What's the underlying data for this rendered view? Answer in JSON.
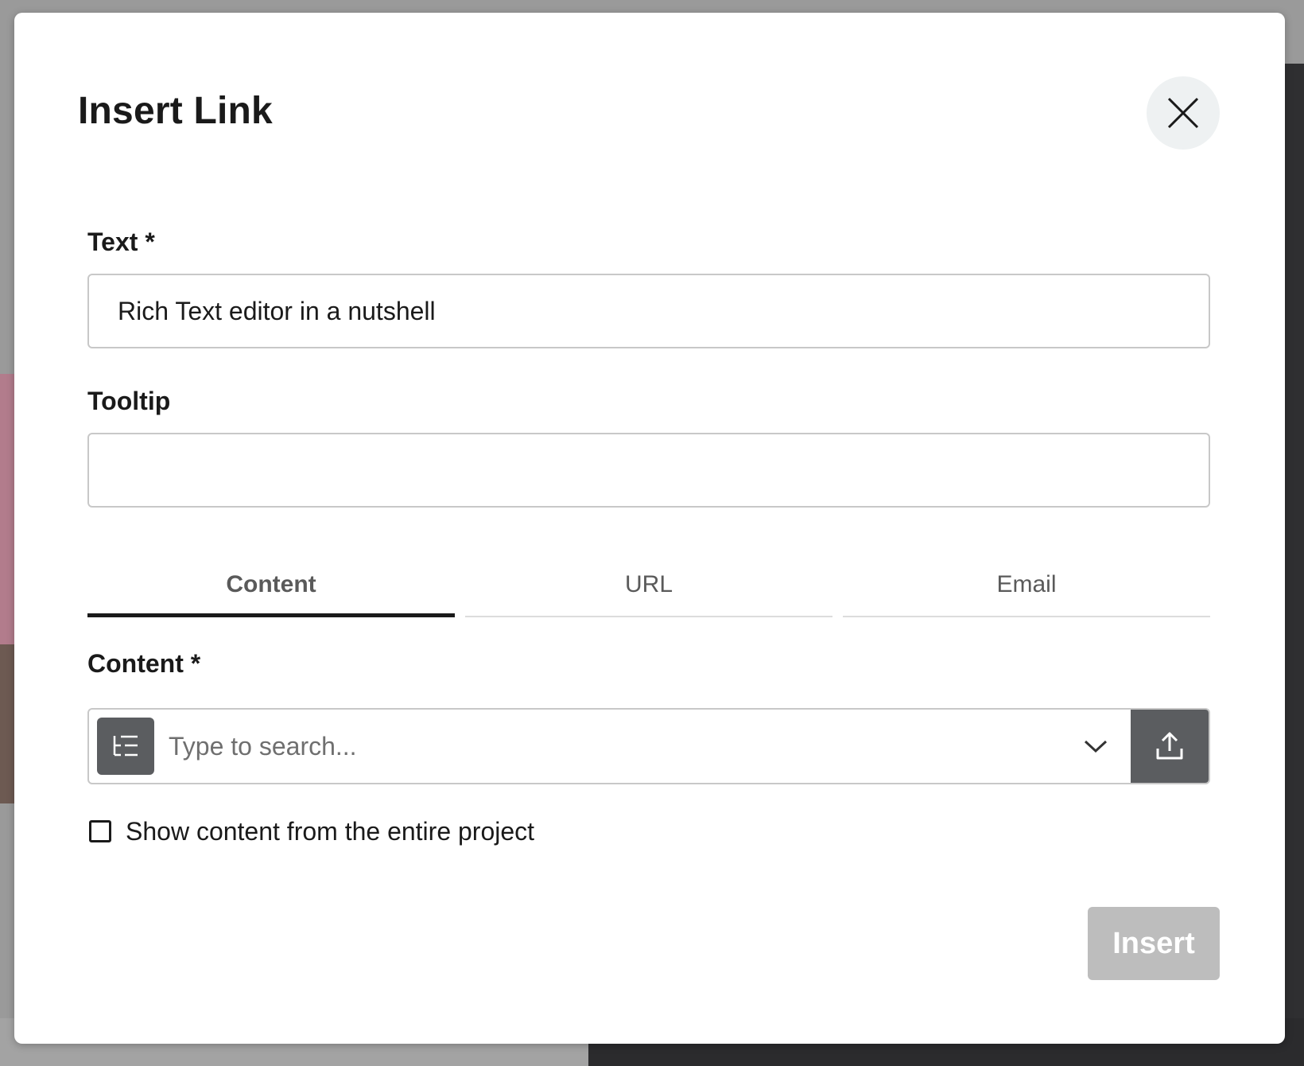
{
  "modal": {
    "title": "Insert Link",
    "close_icon": "close-icon"
  },
  "form": {
    "text_label": "Text *",
    "text_value": "Rich Text editor in a nutshell",
    "tooltip_label": "Tooltip",
    "tooltip_value": ""
  },
  "tabs": [
    {
      "label": "Content",
      "active": true
    },
    {
      "label": "URL",
      "active": false
    },
    {
      "label": "Email",
      "active": false
    }
  ],
  "content_panel": {
    "label": "Content *",
    "search_placeholder": "Type to search...",
    "tree_icon": "content-tree-icon",
    "dropdown_icon": "chevron-down-icon",
    "upload_icon": "upload-icon",
    "checkbox_label": "Show content from the entire project",
    "checkbox_checked": false
  },
  "footer": {
    "insert_label": "Insert",
    "insert_disabled": true
  },
  "colors": {
    "primary_text": "#1a1a1a",
    "active_tab_underline": "#1a1a1a",
    "icon_box": "#5b5d60",
    "disabled_button": "#bdbdbd"
  }
}
